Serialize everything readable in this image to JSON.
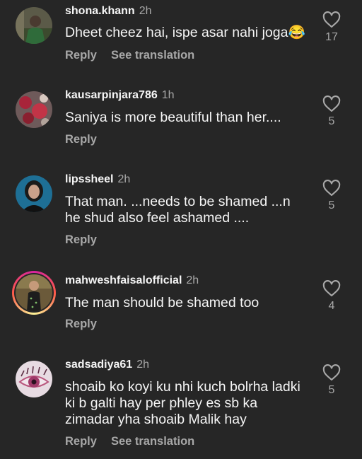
{
  "comments": [
    {
      "username": "shona.khann",
      "time": "2h",
      "text": "Dheet cheez hai, ispe asar nahi joga😂",
      "likes": "17",
      "reply_label": "Reply",
      "translate_label": "See translation",
      "avatar_icon": "avatar-green-dress"
    },
    {
      "username": "kausarpinjara786",
      "time": "1h",
      "text": "Saniya is more beautiful than her....",
      "likes": "5",
      "reply_label": "Reply",
      "avatar_icon": "avatar-red-floral"
    },
    {
      "username": "lipssheel",
      "time": "2h",
      "text": "That man. ...needs to be shamed ...n he shud also feel ashamed ....",
      "likes": "5",
      "reply_label": "Reply",
      "avatar_icon": "avatar-woman-blue"
    },
    {
      "username": "mahweshfaisalofficial",
      "time": "2h",
      "text": "The man should be shamed too",
      "likes": "4",
      "reply_label": "Reply",
      "avatar_icon": "avatar-woman-story-ring"
    },
    {
      "username": "sadsadiya61",
      "time": "2h",
      "text": "shoaib ko koyi ku nhi kuch bolrha ladki ki b galti hay per phley es sb ka zimadar yha shoaib Malik hay",
      "likes": "5",
      "reply_label": "Reply",
      "translate_label": "See translation",
      "avatar_icon": "avatar-pink-eye"
    }
  ],
  "colors": {
    "background": "#262626",
    "primary_text": "#f5f5f5",
    "secondary_text": "#a8a8a8",
    "story_ring": "#d6249f"
  }
}
